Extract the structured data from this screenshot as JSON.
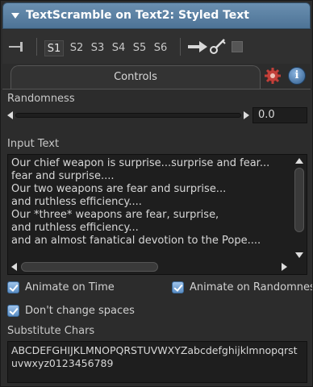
{
  "panel": {
    "title": "TextScramble on Text2: Styled Text"
  },
  "toolbar": {
    "slots": [
      "S1",
      "S2",
      "S3",
      "S4",
      "S5",
      "S6"
    ],
    "active_slot": "S1"
  },
  "tabs": {
    "controls_label": "Controls"
  },
  "randomness": {
    "label": "Randomness",
    "value": "0.0"
  },
  "input_text": {
    "label": "Input Text",
    "lines": [
      "Our chief weapon is surprise...surprise and fear...",
      "fear and surprise....",
      "Our two weapons are fear and surprise...",
      "and ruthless efficiency....",
      "Our *three* weapons are fear, surprise,",
      "and ruthless efficiency...",
      "and an almost fanatical devotion to the Pope...."
    ]
  },
  "checkboxes": {
    "animate_on_time": "Animate on Time",
    "animate_on_randomness": "Animate on Randomness",
    "dont_change_spaces": "Don't change spaces"
  },
  "substitute": {
    "label": "Substitute Chars",
    "value": "ABCDEFGHIJKLMNOPQRSTUVWXYZabcdefghijklmnopqrstuvwxyz0123456789"
  },
  "colors": {
    "title_bar": "#5a80a4",
    "background": "#2c2c2c",
    "field": "#1e1e1e",
    "checkbox": "#7aa8d8"
  }
}
